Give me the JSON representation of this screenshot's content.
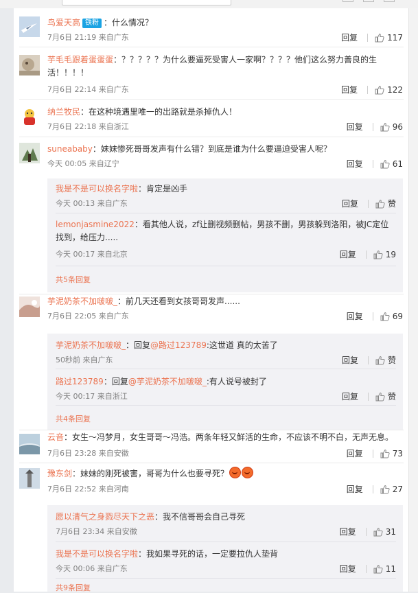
{
  "comments": [
    {
      "user": "鸟爱天高",
      "badge": "铁粉",
      "text": "：什么情况？",
      "time": "7月6日 21:19 来自广东",
      "reply": "回复",
      "likes": "117"
    },
    {
      "user": "芋毛毛跟着蛋蛋蛋",
      "text": "：？？？？？为什么要逼死受害人一家啊？？？？他们这么努力善良的生活！！！！",
      "time": "7月6日 22:14 来自广东",
      "reply": "回复",
      "likes": "122"
    },
    {
      "user": "纳兰牧民",
      "text": "：在这种境遇里唯一的出路就是杀掉仇人！",
      "time": "7月6日 22:18 来自浙江",
      "reply": "回复",
      "likes": "96"
    },
    {
      "user": "suneababy",
      "text": "：妹妹惨死哥哥发声有什么错？到底是谁为什么要逼迫受害人呢？",
      "time": "今天 00:05 来自辽宁",
      "reply": "回复",
      "likes": "61",
      "subreplies": [
        {
          "user": "我是不是可以换名字啦",
          "text": "：肯定是凶手",
          "time": "今天 00:13 来自广东",
          "reply": "回复",
          "likes": "赞"
        },
        {
          "user": "lemonjasmine2022",
          "text": "：看其他人说，zf让删视频删帖，男孩不删，男孩躲到洛阳，被JC定位找到，给压力.....",
          "time": "今天 00:17 来自北京",
          "reply": "回复",
          "likes": "19"
        }
      ],
      "more": "共5条回复"
    },
    {
      "user": "芋泥奶茶不加啵啵_",
      "text": "：前几天还看到女孩哥哥发声......",
      "time": "7月6日 22:05 来自广东",
      "reply": "回复",
      "likes": "69",
      "subreplies": [
        {
          "user": "芋泥奶茶不加啵啵_",
          "prefix": "：回复",
          "mention": "@路过123789",
          "text": ":这世道 真的太苦了",
          "time": "50秒前 来自广东",
          "reply": "回复",
          "likes": "赞"
        },
        {
          "user": "路过123789",
          "prefix": "：回复",
          "mention": "@芋泥奶茶不加啵啵_",
          "text": ":有人说号被封了",
          "time": "今天 00:17 来自浙江",
          "reply": "回复",
          "likes": "赞"
        }
      ],
      "more": "共4条回复"
    },
    {
      "user": "云音",
      "text": "：女生～冯梦月，女生哥哥～冯浩。两条年轻又鲜活的生命，不应该不明不白，无声无息。",
      "time": "7月6日 23:28 来自安徽",
      "reply": "回复",
      "likes": "73"
    },
    {
      "user": "豫东剑",
      "text": "：妹妹的刚死被害，哥哥为什么也要寻死？",
      "time": "7月6日 22:52 来自河南",
      "reply": "回复",
      "likes": "27",
      "subreplies": [
        {
          "user": "愿以清气之身戮尽天下之恶",
          "text": "：我不信哥哥会自己寻死",
          "time": "7月6日 23:34 来自安徽",
          "reply": "回复",
          "likes": "31"
        },
        {
          "user": "我是不是可以换名字啦",
          "text": "：我如果寻死的话，一定要拉仇人垫背",
          "time": "今天 00:06 来自广东",
          "reply": "回复",
          "likes": "11"
        }
      ],
      "more": "共9条回复"
    }
  ],
  "colors": {
    "username": "#eb7350",
    "badge": "#1aa3e3",
    "meta": "#808080",
    "subbox": "#f2f2f5"
  },
  "icons": [
    "thumbs-up-icon",
    "angry-face-emoji"
  ]
}
